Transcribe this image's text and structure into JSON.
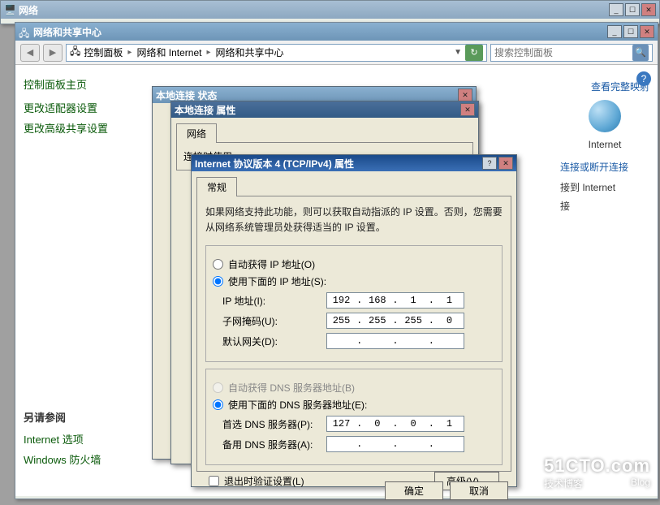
{
  "win_net": {
    "title": "网络"
  },
  "win_nsc": {
    "title": "网络和共享中心",
    "breadcrumb": [
      "控制面板",
      "网络和 Internet",
      "网络和共享中心"
    ],
    "search_placeholder": "搜索控制面板"
  },
  "sidebar": {
    "home": "控制面板主页",
    "links": [
      "更改适配器设置",
      "更改高级共享设置"
    ],
    "see_also": {
      "title": "另请参阅",
      "items": [
        "Internet 选项",
        "Windows 防火墙"
      ]
    }
  },
  "right": {
    "view_map": "查看完整映射",
    "internet": "Internet",
    "conn_disc": "连接或断开连接",
    "access_internet": "接到 Internet",
    "access_lan": "接"
  },
  "win_status": {
    "title": "本地连接 状态"
  },
  "win_props": {
    "title": "本地连接 属性",
    "tab": "网络",
    "txt": "连接时使用:"
  },
  "win_ipv4": {
    "title": "Internet 协议版本 4 (TCP/IPv4) 属性",
    "tab": "常规",
    "desc": "如果网络支持此功能，则可以获取自动指派的 IP 设置。否则，您需要从网络系统管理员处获得适当的 IP 设置。",
    "radio_auto_ip": "自动获得 IP 地址(O)",
    "radio_manual_ip": "使用下面的 IP 地址(S):",
    "lbl_ip": "IP 地址(I):",
    "lbl_mask": "子网掩码(U):",
    "lbl_gw": "默认网关(D):",
    "radio_auto_dns": "自动获得 DNS 服务器地址(B)",
    "radio_manual_dns": "使用下面的 DNS 服务器地址(E):",
    "lbl_dns1": "首选 DNS 服务器(P):",
    "lbl_dns2": "备用 DNS 服务器(A):",
    "chk_validate": "退出时验证设置(L)",
    "btn_adv": "高级(V)...",
    "btn_ok": "确定",
    "btn_cancel": "取消",
    "ip": [
      "192",
      "168",
      "1",
      "1"
    ],
    "mask": [
      "255",
      "255",
      "255",
      "0"
    ],
    "gw": [
      "",
      "",
      "",
      ""
    ],
    "dns1": [
      "127",
      "0",
      "0",
      "1"
    ],
    "dns2": [
      "",
      "",
      "",
      ""
    ]
  },
  "watermark": {
    "big": "51CTO.com",
    "sm1": "技术博客",
    "sm2": "Blog"
  }
}
